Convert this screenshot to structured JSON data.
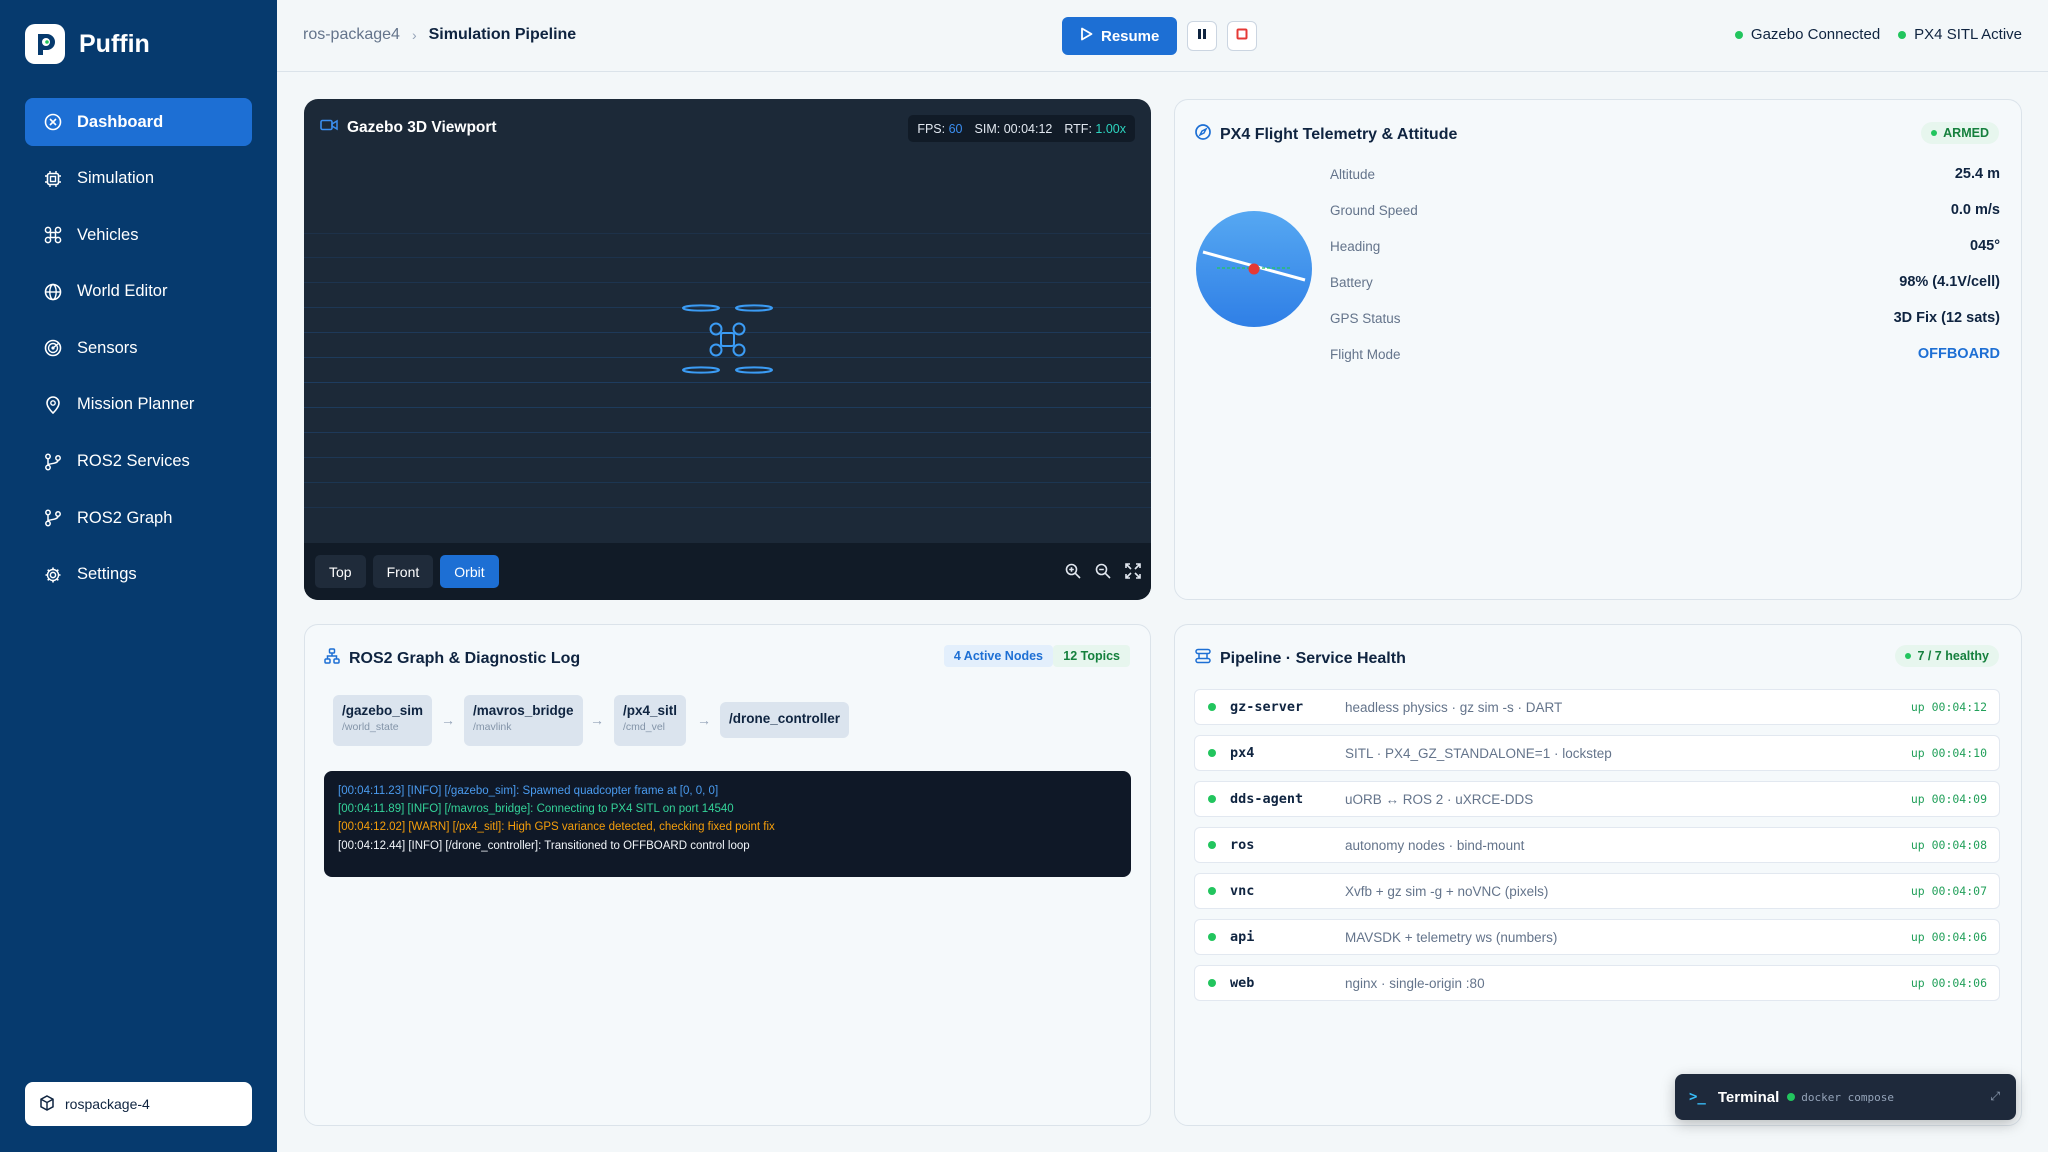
{
  "app": {
    "name": "Puffin"
  },
  "sidebar": {
    "items": [
      {
        "label": "Dashboard",
        "icon": "dashboard-icon",
        "active": true
      },
      {
        "label": "Simulation",
        "icon": "cpu-icon"
      },
      {
        "label": "Vehicles",
        "icon": "drone-icon"
      },
      {
        "label": "World Editor",
        "icon": "globe-icon"
      },
      {
        "label": "Sensors",
        "icon": "radar-icon"
      },
      {
        "label": "Mission Planner",
        "icon": "map-pin-icon"
      },
      {
        "label": "ROS2 Services",
        "icon": "git-branch-icon"
      },
      {
        "label": "ROS2 Graph",
        "icon": "git-branch-icon"
      },
      {
        "label": "Settings",
        "icon": "gear-icon"
      }
    ],
    "workspace": "rospackage-4"
  },
  "topbar": {
    "breadcrumb_root": "ros-package4",
    "breadcrumb_current": "Simulation Pipeline",
    "resume_label": "Resume",
    "status_gazebo": "Gazebo Connected",
    "status_px4": "PX4 SITL Active"
  },
  "viewport": {
    "title": "Gazebo 3D Viewport",
    "fps_label": "FPS:",
    "fps": "60",
    "sim_label": "SIM:",
    "sim": "00:04:12",
    "rtf_label": "RTF:",
    "rtf": "1.00x",
    "views": [
      "Top",
      "Front",
      "Orbit"
    ],
    "active_view": "Orbit"
  },
  "telemetry": {
    "title": "PX4 Flight Telemetry & Attitude",
    "badge": "ARMED",
    "rows": [
      {
        "label": "Altitude",
        "value": "25.4 m"
      },
      {
        "label": "Ground Speed",
        "value": "0.0 m/s"
      },
      {
        "label": "Heading",
        "value": "045°"
      },
      {
        "label": "Battery",
        "value": "98% (4.1V/cell)"
      },
      {
        "label": "GPS Status",
        "value": "3D Fix (12 sats)"
      },
      {
        "label": "Flight Mode",
        "value": "OFFBOARD"
      }
    ]
  },
  "graph": {
    "title": "ROS2 Graph & Diagnostic Log",
    "badge_nodes": "4 Active Nodes",
    "badge_topics": "12 Topics",
    "nodes": [
      {
        "name": "/gazebo_sim",
        "topic": "/world_state"
      },
      {
        "name": "/mavros_bridge",
        "topic": "/mavlink"
      },
      {
        "name": "/px4_sitl",
        "topic": "/cmd_vel"
      },
      {
        "name": "/drone_controller",
        "topic": ""
      }
    ],
    "log": [
      "[00:04:11.23] [INFO] [/gazebo_sim]: Spawned quadcopter frame at [0, 0, 0]",
      "[00:04:11.89] [INFO] [/mavros_bridge]: Connecting to PX4 SITL on port 14540",
      "[00:04:12.02] [WARN] [/px4_sitl]: High GPS variance detected, checking fixed point fix",
      "[00:04:12.44] [INFO] [/drone_controller]: Transitioned to OFFBOARD control loop"
    ]
  },
  "pipeline": {
    "title": "Pipeline · Service Health",
    "badge": "7 / 7 healthy",
    "services": [
      {
        "name": "gz-server",
        "desc": "headless physics · gz sim -s · DART",
        "uptime": "up 00:04:12"
      },
      {
        "name": "px4",
        "desc": "SITL · PX4_GZ_STANDALONE=1 · lockstep",
        "uptime": "up 00:04:10"
      },
      {
        "name": "dds-agent",
        "desc": "uORB ↔ ROS 2 · uXRCE-DDS",
        "uptime": "up 00:04:09"
      },
      {
        "name": "ros",
        "desc": "autonomy nodes · bind-mount",
        "uptime": "up 00:04:08"
      },
      {
        "name": "vnc",
        "desc": "Xvfb + gz sim -g + noVNC  (pixels)",
        "uptime": "up 00:04:07"
      },
      {
        "name": "api",
        "desc": "MAVSDK + telemetry ws  (numbers)",
        "uptime": "up 00:04:06"
      },
      {
        "name": "web",
        "desc": "nginx · single-origin :80",
        "uptime": "up 00:04:06"
      }
    ]
  },
  "terminal": {
    "prompt": ">_",
    "title": "Terminal",
    "sub": "docker compose"
  }
}
